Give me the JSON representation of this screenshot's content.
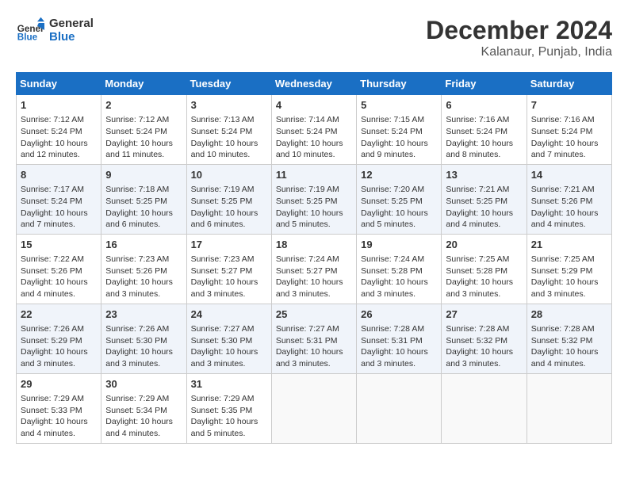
{
  "logo": {
    "text_general": "General",
    "text_blue": "Blue"
  },
  "title": "December 2024",
  "location": "Kalanaur, Punjab, India",
  "days_of_week": [
    "Sunday",
    "Monday",
    "Tuesday",
    "Wednesday",
    "Thursday",
    "Friday",
    "Saturday"
  ],
  "weeks": [
    [
      {
        "day": "1",
        "sunrise": "Sunrise: 7:12 AM",
        "sunset": "Sunset: 5:24 PM",
        "daylight": "Daylight: 10 hours and 12 minutes."
      },
      {
        "day": "2",
        "sunrise": "Sunrise: 7:12 AM",
        "sunset": "Sunset: 5:24 PM",
        "daylight": "Daylight: 10 hours and 11 minutes."
      },
      {
        "day": "3",
        "sunrise": "Sunrise: 7:13 AM",
        "sunset": "Sunset: 5:24 PM",
        "daylight": "Daylight: 10 hours and 10 minutes."
      },
      {
        "day": "4",
        "sunrise": "Sunrise: 7:14 AM",
        "sunset": "Sunset: 5:24 PM",
        "daylight": "Daylight: 10 hours and 10 minutes."
      },
      {
        "day": "5",
        "sunrise": "Sunrise: 7:15 AM",
        "sunset": "Sunset: 5:24 PM",
        "daylight": "Daylight: 10 hours and 9 minutes."
      },
      {
        "day": "6",
        "sunrise": "Sunrise: 7:16 AM",
        "sunset": "Sunset: 5:24 PM",
        "daylight": "Daylight: 10 hours and 8 minutes."
      },
      {
        "day": "7",
        "sunrise": "Sunrise: 7:16 AM",
        "sunset": "Sunset: 5:24 PM",
        "daylight": "Daylight: 10 hours and 7 minutes."
      }
    ],
    [
      {
        "day": "8",
        "sunrise": "Sunrise: 7:17 AM",
        "sunset": "Sunset: 5:24 PM",
        "daylight": "Daylight: 10 hours and 7 minutes."
      },
      {
        "day": "9",
        "sunrise": "Sunrise: 7:18 AM",
        "sunset": "Sunset: 5:25 PM",
        "daylight": "Daylight: 10 hours and 6 minutes."
      },
      {
        "day": "10",
        "sunrise": "Sunrise: 7:19 AM",
        "sunset": "Sunset: 5:25 PM",
        "daylight": "Daylight: 10 hours and 6 minutes."
      },
      {
        "day": "11",
        "sunrise": "Sunrise: 7:19 AM",
        "sunset": "Sunset: 5:25 PM",
        "daylight": "Daylight: 10 hours and 5 minutes."
      },
      {
        "day": "12",
        "sunrise": "Sunrise: 7:20 AM",
        "sunset": "Sunset: 5:25 PM",
        "daylight": "Daylight: 10 hours and 5 minutes."
      },
      {
        "day": "13",
        "sunrise": "Sunrise: 7:21 AM",
        "sunset": "Sunset: 5:25 PM",
        "daylight": "Daylight: 10 hours and 4 minutes."
      },
      {
        "day": "14",
        "sunrise": "Sunrise: 7:21 AM",
        "sunset": "Sunset: 5:26 PM",
        "daylight": "Daylight: 10 hours and 4 minutes."
      }
    ],
    [
      {
        "day": "15",
        "sunrise": "Sunrise: 7:22 AM",
        "sunset": "Sunset: 5:26 PM",
        "daylight": "Daylight: 10 hours and 4 minutes."
      },
      {
        "day": "16",
        "sunrise": "Sunrise: 7:23 AM",
        "sunset": "Sunset: 5:26 PM",
        "daylight": "Daylight: 10 hours and 3 minutes."
      },
      {
        "day": "17",
        "sunrise": "Sunrise: 7:23 AM",
        "sunset": "Sunset: 5:27 PM",
        "daylight": "Daylight: 10 hours and 3 minutes."
      },
      {
        "day": "18",
        "sunrise": "Sunrise: 7:24 AM",
        "sunset": "Sunset: 5:27 PM",
        "daylight": "Daylight: 10 hours and 3 minutes."
      },
      {
        "day": "19",
        "sunrise": "Sunrise: 7:24 AM",
        "sunset": "Sunset: 5:28 PM",
        "daylight": "Daylight: 10 hours and 3 minutes."
      },
      {
        "day": "20",
        "sunrise": "Sunrise: 7:25 AM",
        "sunset": "Sunset: 5:28 PM",
        "daylight": "Daylight: 10 hours and 3 minutes."
      },
      {
        "day": "21",
        "sunrise": "Sunrise: 7:25 AM",
        "sunset": "Sunset: 5:29 PM",
        "daylight": "Daylight: 10 hours and 3 minutes."
      }
    ],
    [
      {
        "day": "22",
        "sunrise": "Sunrise: 7:26 AM",
        "sunset": "Sunset: 5:29 PM",
        "daylight": "Daylight: 10 hours and 3 minutes."
      },
      {
        "day": "23",
        "sunrise": "Sunrise: 7:26 AM",
        "sunset": "Sunset: 5:30 PM",
        "daylight": "Daylight: 10 hours and 3 minutes."
      },
      {
        "day": "24",
        "sunrise": "Sunrise: 7:27 AM",
        "sunset": "Sunset: 5:30 PM",
        "daylight": "Daylight: 10 hours and 3 minutes."
      },
      {
        "day": "25",
        "sunrise": "Sunrise: 7:27 AM",
        "sunset": "Sunset: 5:31 PM",
        "daylight": "Daylight: 10 hours and 3 minutes."
      },
      {
        "day": "26",
        "sunrise": "Sunrise: 7:28 AM",
        "sunset": "Sunset: 5:31 PM",
        "daylight": "Daylight: 10 hours and 3 minutes."
      },
      {
        "day": "27",
        "sunrise": "Sunrise: 7:28 AM",
        "sunset": "Sunset: 5:32 PM",
        "daylight": "Daylight: 10 hours and 3 minutes."
      },
      {
        "day": "28",
        "sunrise": "Sunrise: 7:28 AM",
        "sunset": "Sunset: 5:32 PM",
        "daylight": "Daylight: 10 hours and 4 minutes."
      }
    ],
    [
      {
        "day": "29",
        "sunrise": "Sunrise: 7:29 AM",
        "sunset": "Sunset: 5:33 PM",
        "daylight": "Daylight: 10 hours and 4 minutes."
      },
      {
        "day": "30",
        "sunrise": "Sunrise: 7:29 AM",
        "sunset": "Sunset: 5:34 PM",
        "daylight": "Daylight: 10 hours and 4 minutes."
      },
      {
        "day": "31",
        "sunrise": "Sunrise: 7:29 AM",
        "sunset": "Sunset: 5:35 PM",
        "daylight": "Daylight: 10 hours and 5 minutes."
      },
      null,
      null,
      null,
      null
    ]
  ]
}
